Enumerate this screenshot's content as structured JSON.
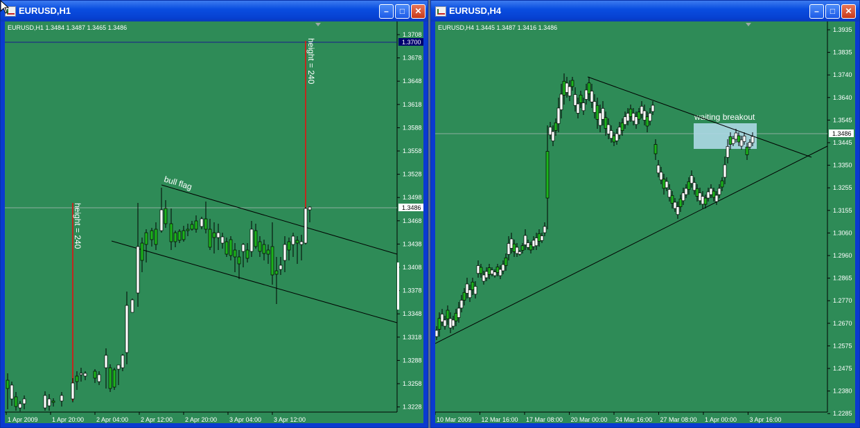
{
  "windows": [
    {
      "title": "EURUSD,H1",
      "ohlc": "EURUSD,H1  1.3484 1.3487 1.3465 1.3486",
      "price_labels": [
        "1.3708",
        "1.3678",
        "1.3648",
        "1.3618",
        "1.3588",
        "1.3558",
        "1.3528",
        "1.3498",
        "1.3468",
        "1.3438",
        "1.3408",
        "1.3378",
        "1.3348",
        "1.3318",
        "1.3288",
        "1.3258",
        "1.3228"
      ],
      "highlight_labels": [
        {
          "text": "1.3700",
          "bg": "#00006e",
          "fg": "#ffffff"
        },
        {
          "text": "1.3486",
          "bg": "#ffffff",
          "fg": "#000000"
        }
      ],
      "time_labels": [
        "1 Apr 2009",
        "1 Apr 20:00",
        "2 Apr 04:00",
        "2 Apr 12:00",
        "2 Apr 20:00",
        "3 Apr 04:00",
        "3 Apr 12:00"
      ],
      "annotations": [
        "height = 240",
        "height = 240",
        "bull flag"
      ]
    },
    {
      "title": "EURUSD,H4",
      "ohlc": "EURUSD,H4  1.3445 1.3487 1.3416 1.3486",
      "price_labels": [
        "1.3935",
        "1.3835",
        "1.3740",
        "1.3640",
        "1.3545",
        "1.3445",
        "1.3350",
        "1.3255",
        "1.3155",
        "1.3060",
        "1.2960",
        "1.2865",
        "1.2770",
        "1.2670",
        "1.2575",
        "1.2475",
        "1.2380",
        "1.2285"
      ],
      "highlight_labels": [
        {
          "text": "1.3486",
          "bg": "#ffffff",
          "fg": "#000000"
        }
      ],
      "time_labels": [
        "10 Mar 2009",
        "12 Mar 16:00",
        "17 Mar 08:00",
        "20 Mar 00:00",
        "24 Mar 16:00",
        "27 Mar 08:00",
        "1 Apr 00:00",
        "3 Apr 16:00"
      ],
      "annotations": [
        "waiting breakout"
      ]
    }
  ],
  "colors": {
    "chart_bg": "#2e8b57",
    "bull": "#ffffff",
    "bear": "#1db31d",
    "line": "#000000",
    "height_bar": "#c0281e",
    "box": "#add8e6"
  }
}
